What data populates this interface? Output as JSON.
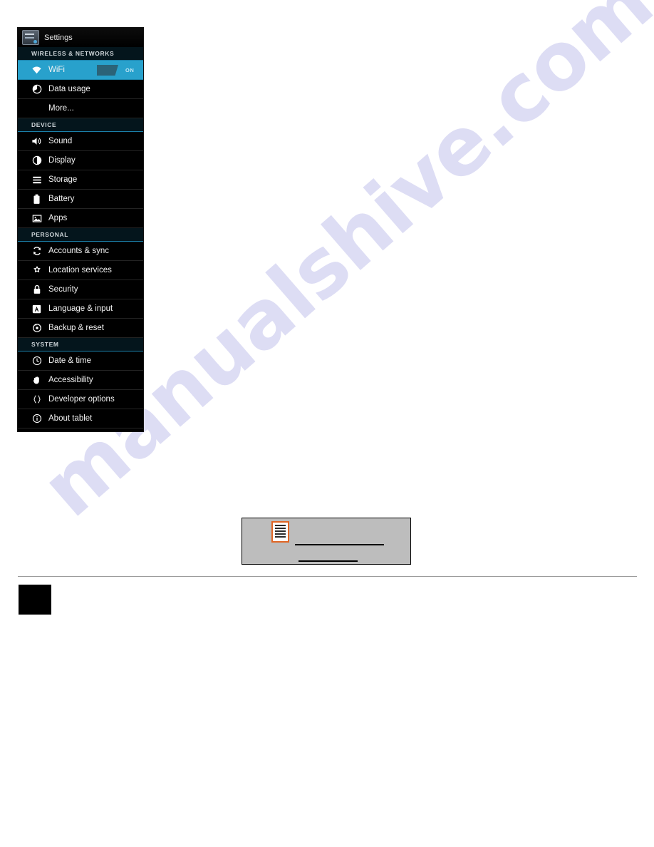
{
  "page": {
    "watermark_text": "manualshive.com",
    "accent_blue": "#28a1cc",
    "panel_background": "#000000",
    "figure_icon_border": "#e06524"
  },
  "settings": {
    "app_bar": {
      "title": "Settings",
      "icon": "settings-app-icon"
    },
    "sections": [
      {
        "header": "WIRELESS & NETWORKS",
        "items": [
          {
            "label": "WiFi",
            "icon": "wifi-icon",
            "selected": true,
            "toggle": "ON"
          },
          {
            "label": "Data usage",
            "icon": "data-usage-icon",
            "selected": false
          },
          {
            "label": "More...",
            "icon": null,
            "selected": false
          }
        ]
      },
      {
        "header": "DEVICE",
        "items": [
          {
            "label": "Sound",
            "icon": "sound-icon",
            "selected": false
          },
          {
            "label": "Display",
            "icon": "display-icon",
            "selected": false
          },
          {
            "label": "Storage",
            "icon": "storage-icon",
            "selected": false
          },
          {
            "label": "Battery",
            "icon": "battery-icon",
            "selected": false
          },
          {
            "label": "Apps",
            "icon": "apps-icon",
            "selected": false
          }
        ]
      },
      {
        "header": "PERSONAL",
        "items": [
          {
            "label": "Accounts & sync",
            "icon": "sync-icon",
            "selected": false
          },
          {
            "label": "Location services",
            "icon": "location-icon",
            "selected": false
          },
          {
            "label": "Security",
            "icon": "lock-icon",
            "selected": false
          },
          {
            "label": "Language & input",
            "icon": "language-icon",
            "selected": false
          },
          {
            "label": "Backup & reset",
            "icon": "backup-reset-icon",
            "selected": false
          }
        ]
      },
      {
        "header": "SYSTEM",
        "items": [
          {
            "label": "Date & time",
            "icon": "clock-icon",
            "selected": false
          },
          {
            "label": "Accessibility",
            "icon": "hand-icon",
            "selected": false
          },
          {
            "label": "Developer options",
            "icon": "braces-icon",
            "selected": false
          },
          {
            "label": "About tablet",
            "icon": "info-icon",
            "selected": false
          }
        ]
      }
    ]
  },
  "figure": {
    "icon": "list-document-icon",
    "rules": 2
  }
}
